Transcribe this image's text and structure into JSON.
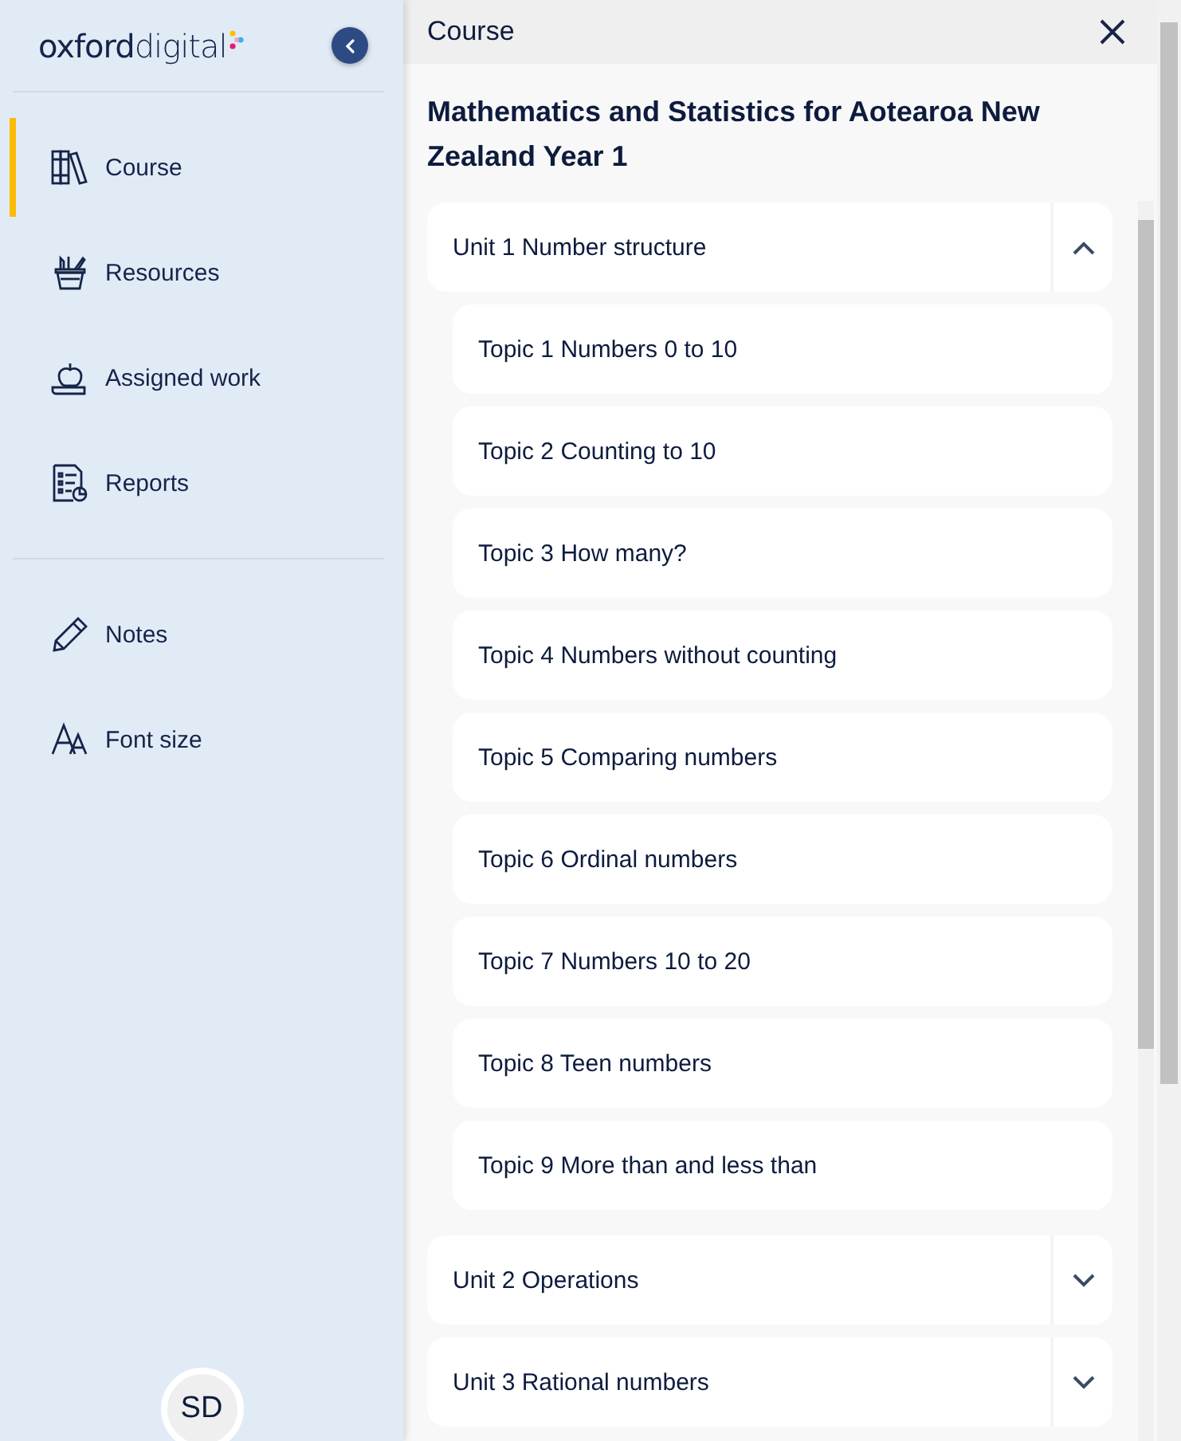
{
  "sidebar": {
    "logo": "**oxford**digital",
    "nav_groups": [
      [
        {
          "label": "Course",
          "selected": true
        },
        {
          "label": "Resources",
          "selected": false
        },
        {
          "label": "Assigned work",
          "selected": false
        },
        {
          "label": "Reports",
          "selected": false
        }
      ],
      [
        {
          "label": "Notes",
          "selected": false
        },
        {
          "label": "Font size",
          "selected": false
        }
      ]
    ],
    "avatar": "SD"
  },
  "panel": {
    "title": "Course",
    "heading": "Mathematics and Statistics for Aotearoa New Zealand Year 1",
    "units": [
      {
        "title": "Unit 1 Number structure",
        "expanded": true,
        "topics": [
          "Topic 1 Numbers 0 to 10",
          "Topic 2 Counting to 10",
          "Topic 3 How many?",
          "Topic 4 Numbers without counting",
          "Topic 5 Comparing numbers",
          "Topic 6 Ordinal numbers",
          "Topic 7 Numbers 10 to 20",
          "Topic 8 Teen numbers",
          "Topic 9 More than and less than"
        ]
      },
      {
        "title": "Unit 2 Operations",
        "expanded": false
      },
      {
        "title": "Unit 3 Rational numbers",
        "expanded": false
      }
    ]
  }
}
